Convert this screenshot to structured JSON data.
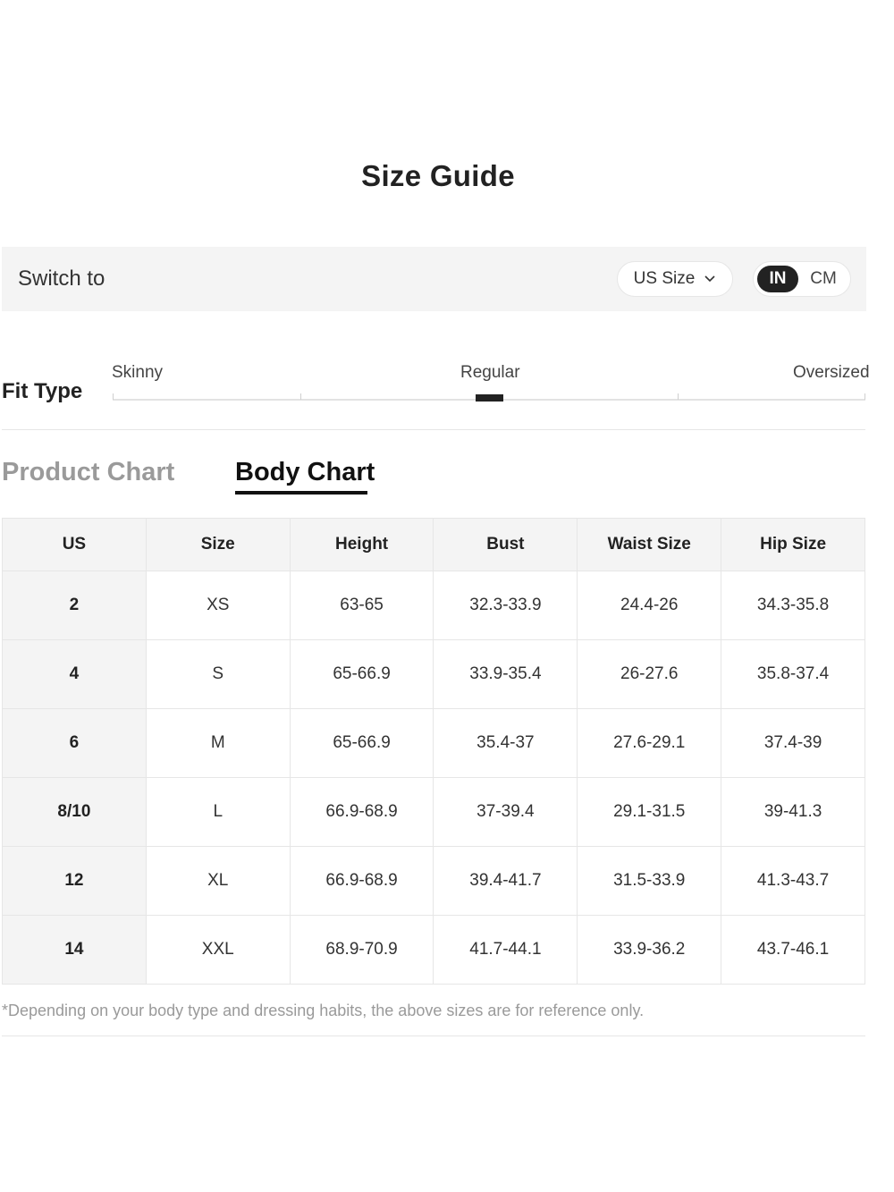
{
  "title": "Size Guide",
  "switch": {
    "label": "Switch to",
    "size_system": "US Size",
    "units": [
      "IN",
      "CM"
    ],
    "selected_unit": "IN"
  },
  "fit_type": {
    "label": "Fit Type",
    "options": [
      "Skinny",
      "Regular",
      "Oversized"
    ],
    "selected": "Regular"
  },
  "tabs": {
    "product": "Product Chart",
    "body": "Body Chart",
    "active": "Body Chart"
  },
  "table": {
    "headers": [
      "US",
      "Size",
      "Height",
      "Bust",
      "Waist Size",
      "Hip Size"
    ],
    "rows": [
      [
        "2",
        "XS",
        "63-65",
        "32.3-33.9",
        "24.4-26",
        "34.3-35.8"
      ],
      [
        "4",
        "S",
        "65-66.9",
        "33.9-35.4",
        "26-27.6",
        "35.8-37.4"
      ],
      [
        "6",
        "M",
        "65-66.9",
        "35.4-37",
        "27.6-29.1",
        "37.4-39"
      ],
      [
        "8/10",
        "L",
        "66.9-68.9",
        "37-39.4",
        "29.1-31.5",
        "39-41.3"
      ],
      [
        "12",
        "XL",
        "66.9-68.9",
        "39.4-41.7",
        "31.5-33.9",
        "41.3-43.7"
      ],
      [
        "14",
        "XXL",
        "68.9-70.9",
        "41.7-44.1",
        "33.9-36.2",
        "43.7-46.1"
      ]
    ]
  },
  "note": "*Depending on your body type and dressing habits, the above sizes are for reference only.",
  "icons": {
    "dropdown": "chevron-down-icon"
  },
  "colors": {
    "accent": "#222222",
    "panel_background": "#f4f4f4",
    "muted_text": "#9a9a9a",
    "border": "#e6e6e6"
  }
}
